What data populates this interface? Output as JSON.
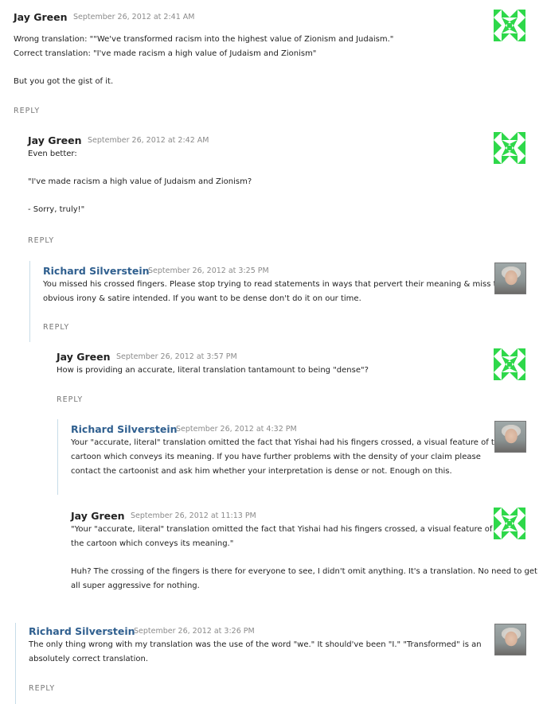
{
  "colors": {
    "owner_author": "#2f5f8f",
    "author": "#222222",
    "date": "#8a8a8a",
    "reply": "#777777",
    "owner_border": "#c7dce8",
    "identicon_green": "#2ed84a"
  },
  "comments": [
    {
      "author": "Jay Green",
      "date": "September 26, 2012 at 2:41 AM",
      "avatar": "green-identicon",
      "paragraphs": [
        "Wrong translation: \"\"We've transformed racism into the highest value of Zionism and Judaism.\"\nCorrect translation: \"I've made racism a high value of Judaism and Zionism\"",
        "But you got the gist of it."
      ],
      "reply_label": "REPLY"
    },
    {
      "author": "Jay Green",
      "date": "September 26, 2012 at 2:42 AM",
      "avatar": "green-identicon",
      "paragraphs": [
        "Even better:",
        "\"I've made racism a high value of Judaism and Zionism?",
        "- Sorry, truly!\""
      ],
      "reply_label": "REPLY"
    },
    {
      "author": "Richard Silverstein",
      "date": "September 26, 2012 at 3:25 PM",
      "avatar": "photo",
      "paragraphs": [
        "You missed his crossed fingers. Please stop trying to read statements in ways that pervert their meaning & miss the\nobvious irony & satire intended. If you want to be dense don't do it on our time."
      ],
      "reply_label": "REPLY"
    },
    {
      "author": "Jay Green",
      "date": "September 26, 2012 at 3:57 PM",
      "avatar": "green-identicon",
      "paragraphs": [
        "How is providing an accurate, literal translation tantamount to being \"dense\"?"
      ],
      "reply_label": "REPLY"
    },
    {
      "author": "Richard Silverstein",
      "date": "September 26, 2012 at 4:32 PM",
      "avatar": "photo",
      "paragraphs": [
        "Your \"accurate, literal\" translation omitted the fact that Yishai had his fingers crossed, a visual feature of the\ncartoon which conveys its meaning. If you have further problems with the density of your claim please\ncontact the cartoonist and ask him whether your interpretation is dense or not. Enough on this."
      ]
    },
    {
      "author": "Jay Green",
      "date": "September 26, 2012 at 11:13 PM",
      "avatar": "green-identicon",
      "paragraphs": [
        "\"Your \"accurate, literal\" translation omitted the fact that Yishai had his fingers crossed, a visual feature of\nthe cartoon which conveys its meaning.\"",
        "Huh? The crossing of the fingers is there for everyone to see, I didn't omit anything. It's a translation. No need to get\nall super aggressive for nothing."
      ]
    },
    {
      "author": "Richard Silverstein",
      "date": "September 26, 2012 at 3:26 PM",
      "avatar": "photo",
      "paragraphs": [
        "The only thing wrong with my translation was the use of the word \"we.\" It should've been \"I.\" \"Transformed\" is an\nabsolutely correct translation."
      ],
      "reply_label": "REPLY"
    }
  ]
}
